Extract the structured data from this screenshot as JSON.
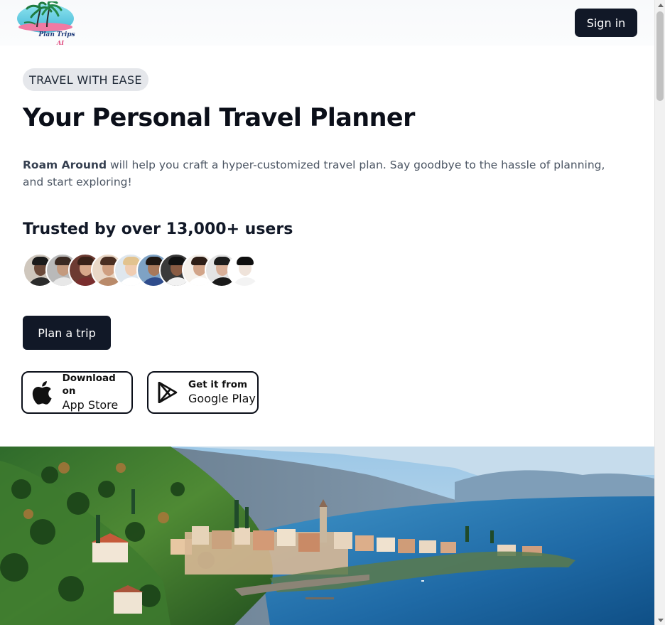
{
  "header": {
    "logo_text": "Plan Trips",
    "logo_sub": "AI",
    "signin_label": "Sign in"
  },
  "hero": {
    "tag": "TRAVEL WITH EASE",
    "title": "Your Personal Travel Planner",
    "desc_brand": "Roam Around",
    "desc_rest": " will help you craft a hyper-customized travel plan. Say goodbye to the hassle of planning, and start exploring!",
    "trusted": "Trusted by over 13,000+ users",
    "plan_label": "Plan a trip"
  },
  "stores": {
    "apple_small": "Download on",
    "apple_big": "App Store",
    "google_small": "Get it from",
    "google_big": "Google Play"
  },
  "avatars": [
    {
      "skin": "#6b4a3a",
      "hair": "#1a1a1a",
      "bg": "#cfc7bd",
      "shirt": "#2b2b2b"
    },
    {
      "skin": "#c49a7e",
      "hair": "#3b2a22",
      "bg": "#b9b9b9",
      "shirt": "#e8e8e8"
    },
    {
      "skin": "#d8a88b",
      "hair": "#3a2118",
      "bg": "#6d3b32",
      "shirt": "#7a2e2e"
    },
    {
      "skin": "#cf9f80",
      "hair": "#4a2f22",
      "bg": "#e9d7c6",
      "shirt": "#b98a6a"
    },
    {
      "skin": "#f0cdb2",
      "hair": "#e2c38f",
      "bg": "#dfe7ee",
      "shirt": "#ffffff"
    },
    {
      "skin": "#a8785a",
      "hair": "#1f1712",
      "bg": "#7ea2c4",
      "shirt": "#2f4c8c"
    },
    {
      "skin": "#8a5c44",
      "hair": "#111111",
      "bg": "#3a3a3a",
      "shirt": "#f2f2f2"
    },
    {
      "skin": "#d2a488",
      "hair": "#2e1e16",
      "bg": "#f5f0ea",
      "shirt": "#ffffff"
    },
    {
      "skin": "#d9b099",
      "hair": "#1c1c1c",
      "bg": "#e4e4e4",
      "shirt": "#1a1a1a"
    },
    {
      "skin": "#efe3da",
      "hair": "#0f0f0f",
      "bg": "#ffffff",
      "shirt": "#f3f3f3"
    }
  ],
  "colors": {
    "primary": "#111827",
    "tag_bg": "#e5e7eb",
    "text_muted": "#4b5563"
  },
  "icons": {
    "apple": "apple-logo-icon",
    "google": "google-play-icon"
  }
}
